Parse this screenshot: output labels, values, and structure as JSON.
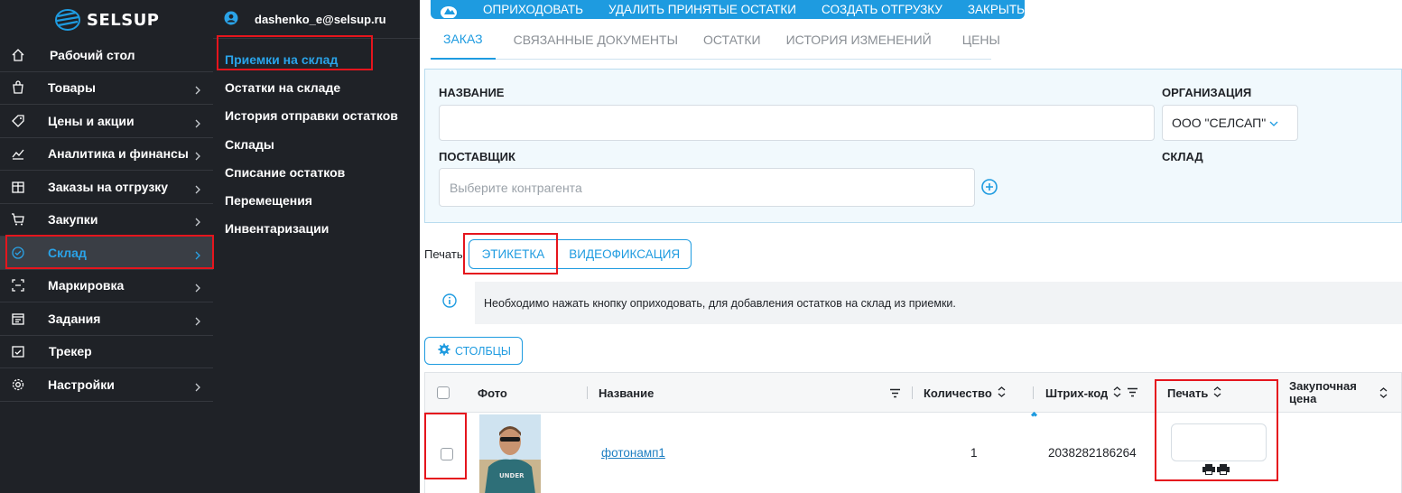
{
  "brand": {
    "name": "SELSUP"
  },
  "sidebar": {
    "items": [
      {
        "label": "Рабочий стол",
        "icon": "home-icon",
        "chevron": false
      },
      {
        "label": "Товары",
        "icon": "bag-icon",
        "chevron": true
      },
      {
        "label": "Цены и акции",
        "icon": "tag-icon",
        "chevron": true
      },
      {
        "label": "Аналитика и финансы",
        "icon": "chart-icon",
        "chevron": true
      },
      {
        "label": "Заказы на отгрузку",
        "icon": "box-icon",
        "chevron": true
      },
      {
        "label": "Закупки",
        "icon": "cart-icon",
        "chevron": true
      },
      {
        "label": "Склад",
        "icon": "check-circle-icon",
        "chevron": true,
        "active": true
      },
      {
        "label": "Маркировка",
        "icon": "scan-icon",
        "chevron": true
      },
      {
        "label": "Задания",
        "icon": "calendar-icon",
        "chevron": true
      },
      {
        "label": "Трекер",
        "icon": "calendar-check-icon",
        "chevron": false
      },
      {
        "label": "Настройки",
        "icon": "gear-icon",
        "chevron": true
      }
    ]
  },
  "submenu": {
    "user_email": "dashenko_e@selsup.ru",
    "items": [
      {
        "label": "Приемки на склад",
        "active": true
      },
      {
        "label": "Остатки на складе"
      },
      {
        "label": "История отправки остатков"
      },
      {
        "label": "Склады"
      },
      {
        "label": "Списание остатков"
      },
      {
        "label": "Перемещения"
      },
      {
        "label": "Инвентаризации"
      }
    ]
  },
  "action_bar": {
    "buttons": [
      "ОПРИХОДОВАТЬ",
      "УДАЛИТЬ ПРИНЯТЫЕ ОСТАТКИ",
      "СОЗДАТЬ ОТГРУЗКУ",
      "ЗАКРЫТЬ"
    ]
  },
  "tabs": [
    {
      "label": "ЗАКАЗ",
      "active": true
    },
    {
      "label": "СВЯЗАННЫЕ ДОКУМЕНТЫ"
    },
    {
      "label": "ОСТАТКИ"
    },
    {
      "label": "ИСТОРИЯ ИЗМЕНЕНИЙ"
    },
    {
      "label": "ЦЕНЫ"
    }
  ],
  "form": {
    "name_label": "НАЗВАНИЕ",
    "name_value": "",
    "org_label": "ОРГАНИЗАЦИЯ",
    "org_value": "ООО \"СЕЛСАП\"",
    "supplier_label": "ПОСТАВЩИК",
    "supplier_placeholder": "Выберите контрагента",
    "warehouse_label": "СКЛАД"
  },
  "print": {
    "label": "Печать",
    "buttons": [
      "ЭТИКЕТКА",
      "ВИДЕОФИКСАЦИЯ"
    ]
  },
  "info": {
    "text": "Необходимо нажать кнопку оприходовать, для добавления остатков на склад из приемки."
  },
  "columns_button": "СТОЛБЦЫ",
  "table": {
    "headers": {
      "photo": "Фото",
      "name": "Название",
      "quantity": "Количество",
      "barcode": "Штрих-код",
      "print": "Печать",
      "purchase_price": "Закупочная цена"
    },
    "rows": [
      {
        "name": "фотонамп1",
        "quantity": "1",
        "barcode": "2038282186264",
        "photo_text": "UNDER"
      }
    ]
  },
  "colors": {
    "accent": "#1e9be0",
    "sidebar_bg": "#1f2227",
    "highlight": "#e5151d"
  }
}
